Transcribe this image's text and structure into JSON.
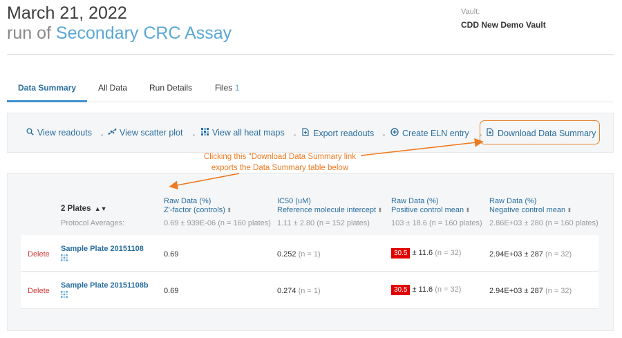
{
  "header": {
    "date": "March 21, 2022",
    "run_prefix": "run of",
    "assay_name": "Secondary CRC Assay",
    "vault_label": "Vault:",
    "vault_name": "CDD New Demo Vault"
  },
  "tabs": [
    {
      "label": "Data Summary",
      "active": true
    },
    {
      "label": "All Data"
    },
    {
      "label": "Run Details"
    },
    {
      "label": "Files",
      "count": "1"
    }
  ],
  "actions": [
    {
      "label": "View readouts",
      "icon": "search-icon"
    },
    {
      "label": "View scatter plot",
      "icon": "scatter-plot-icon"
    },
    {
      "label": "View all heat maps",
      "icon": "heat-map-icon"
    },
    {
      "label": "Export readouts",
      "icon": "export-file-icon"
    },
    {
      "label": "Create ELN entry",
      "icon": "plus-circle-icon"
    },
    {
      "label": "Download Data Summary",
      "icon": "download-file-icon"
    }
  ],
  "annotation": {
    "line1": "Clicking this \"Download Data Summary link",
    "line2": "exports the Data Summary table below"
  },
  "table": {
    "plates_header": "2 Plates",
    "protocol_label": "Protocol Averages:",
    "columns": [
      {
        "line1": "Raw Data (%)",
        "line2": "Z'-factor (controls)",
        "average": "0.69 ± 939E-06 (n = 160 plates)"
      },
      {
        "line1": "IC50 (uM)",
        "line2": "Reference molecule intercept",
        "average": "1.11 ± 2.80 (n = 152 plates)"
      },
      {
        "line1": "Raw Data (%)",
        "line2": "Positive control mean",
        "average": "103 ± 18.6 (n = 160 plates)"
      },
      {
        "line1": "Raw Data (%)",
        "line2": "Negative control mean",
        "average": "2.86E+03 ± 280 (n = 160 plates)"
      }
    ],
    "rows": [
      {
        "delete_label": "Delete",
        "plate": "Sample Plate 20151108",
        "zfactor": "0.69",
        "ic50": "0.252",
        "ic50_n": "(n = 1)",
        "pos_value": "30.5",
        "pos_rest": "± 11.6",
        "pos_n": "(n = 32)",
        "neg": "2.94E+03 ± 287",
        "neg_n": "(n = 32)"
      },
      {
        "delete_label": "Delete",
        "plate": "Sample Plate 20151108b",
        "zfactor": "0.69",
        "ic50": "0.274",
        "ic50_n": "(n = 1)",
        "pos_value": "30.5",
        "pos_rest": "± 11.6",
        "pos_n": "(n = 32)",
        "neg": "2.94E+03 ± 287",
        "neg_n": "(n = 32)"
      }
    ]
  },
  "colors": {
    "accent": "#2a6ea0",
    "annotation": "#ee7a22",
    "flag": "#e00000",
    "delete": "#d03a3a"
  }
}
